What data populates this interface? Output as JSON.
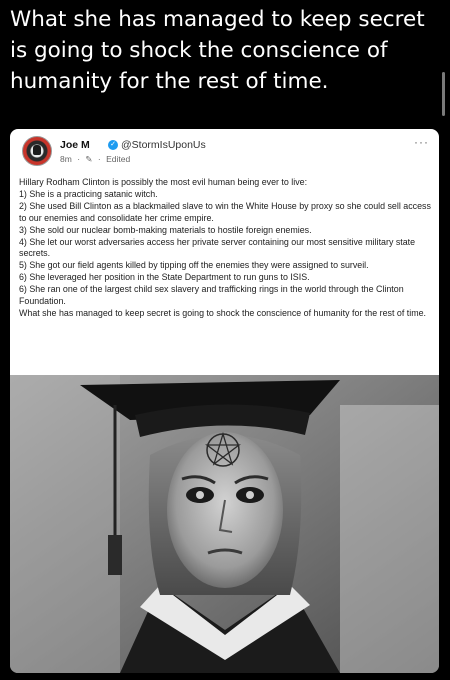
{
  "caption": "What she has managed to keep secret is going to shock the conscience of humanity for the rest of time.",
  "post": {
    "author_name": "Joe M",
    "handle": "@StormIsUponUs",
    "time": "8m",
    "separator": "·",
    "edited_label": "Edited",
    "more_label": "···",
    "paragraphs": [
      "Hillary Rodham Clinton is possibly the most evil human being ever to live:",
      "1) She is a practicing satanic witch.",
      "2) She used Bill Clinton as a blackmailed slave to win the White House by proxy so she could sell access to our enemies and consolidate her crime empire.",
      "3) She sold our nuclear bomb-making materials to hostile foreign enemies.",
      "4) She let our worst adversaries access her private server containing our most sensitive military state secrets.",
      "5) She got our field agents killed by tipping off the enemies they were assigned to surveil.",
      "6) She leveraged her position in the State Department to run guns to ISIS.",
      "6) She ran one of the largest child sex slavery and trafficking rings in the world through the Clinton Foundation.",
      "What she has managed to keep secret is going to shock the conscience of humanity for the rest of time."
    ]
  },
  "icons": {
    "verified": "verified-badge-icon",
    "edit": "edit-pencil-icon",
    "more": "more-options-icon"
  },
  "colors": {
    "background": "#000000",
    "card": "#ffffff",
    "verified": "#1d9bf0"
  }
}
